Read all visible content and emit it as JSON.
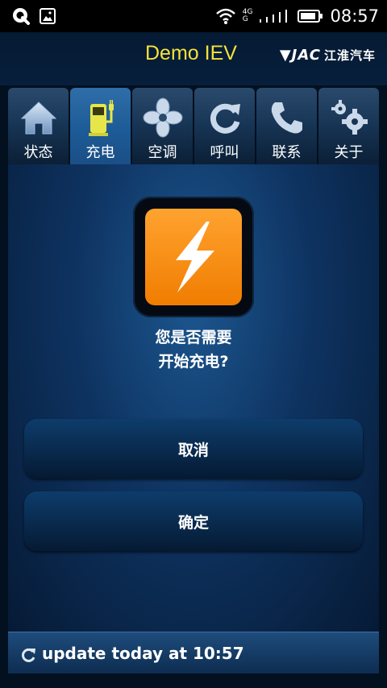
{
  "status_bar": {
    "time": "08:57",
    "network_top": "4G",
    "network_bottom": "G",
    "icons": [
      "app-q-icon",
      "image-notification-icon",
      "wifi-icon",
      "signal-icon",
      "battery-icon"
    ]
  },
  "header": {
    "title": "Demo IEV",
    "brand_logo": "▼JAC",
    "brand_name": "江淮汽车"
  },
  "tabs": [
    {
      "label": "状态",
      "icon": "home-icon",
      "active": false
    },
    {
      "label": "充电",
      "icon": "charging-station-icon",
      "active": true
    },
    {
      "label": "空调",
      "icon": "fan-icon",
      "active": false
    },
    {
      "label": "呼叫",
      "icon": "refresh-icon",
      "active": false
    },
    {
      "label": "联系",
      "icon": "phone-icon",
      "active": false
    },
    {
      "label": "关于",
      "icon": "gears-icon",
      "active": false
    }
  ],
  "main": {
    "icon": "lightning-icon",
    "prompt_line1": "您是否需要",
    "prompt_line2": "开始充电?",
    "cancel_label": "取消",
    "confirm_label": "确定"
  },
  "footer": {
    "update_text": "update today at 10:57"
  },
  "colors": {
    "title": "#f4e23a",
    "accent_orange": "#f68a14",
    "active_tab": "#1d5b97",
    "background": "#03101f"
  }
}
